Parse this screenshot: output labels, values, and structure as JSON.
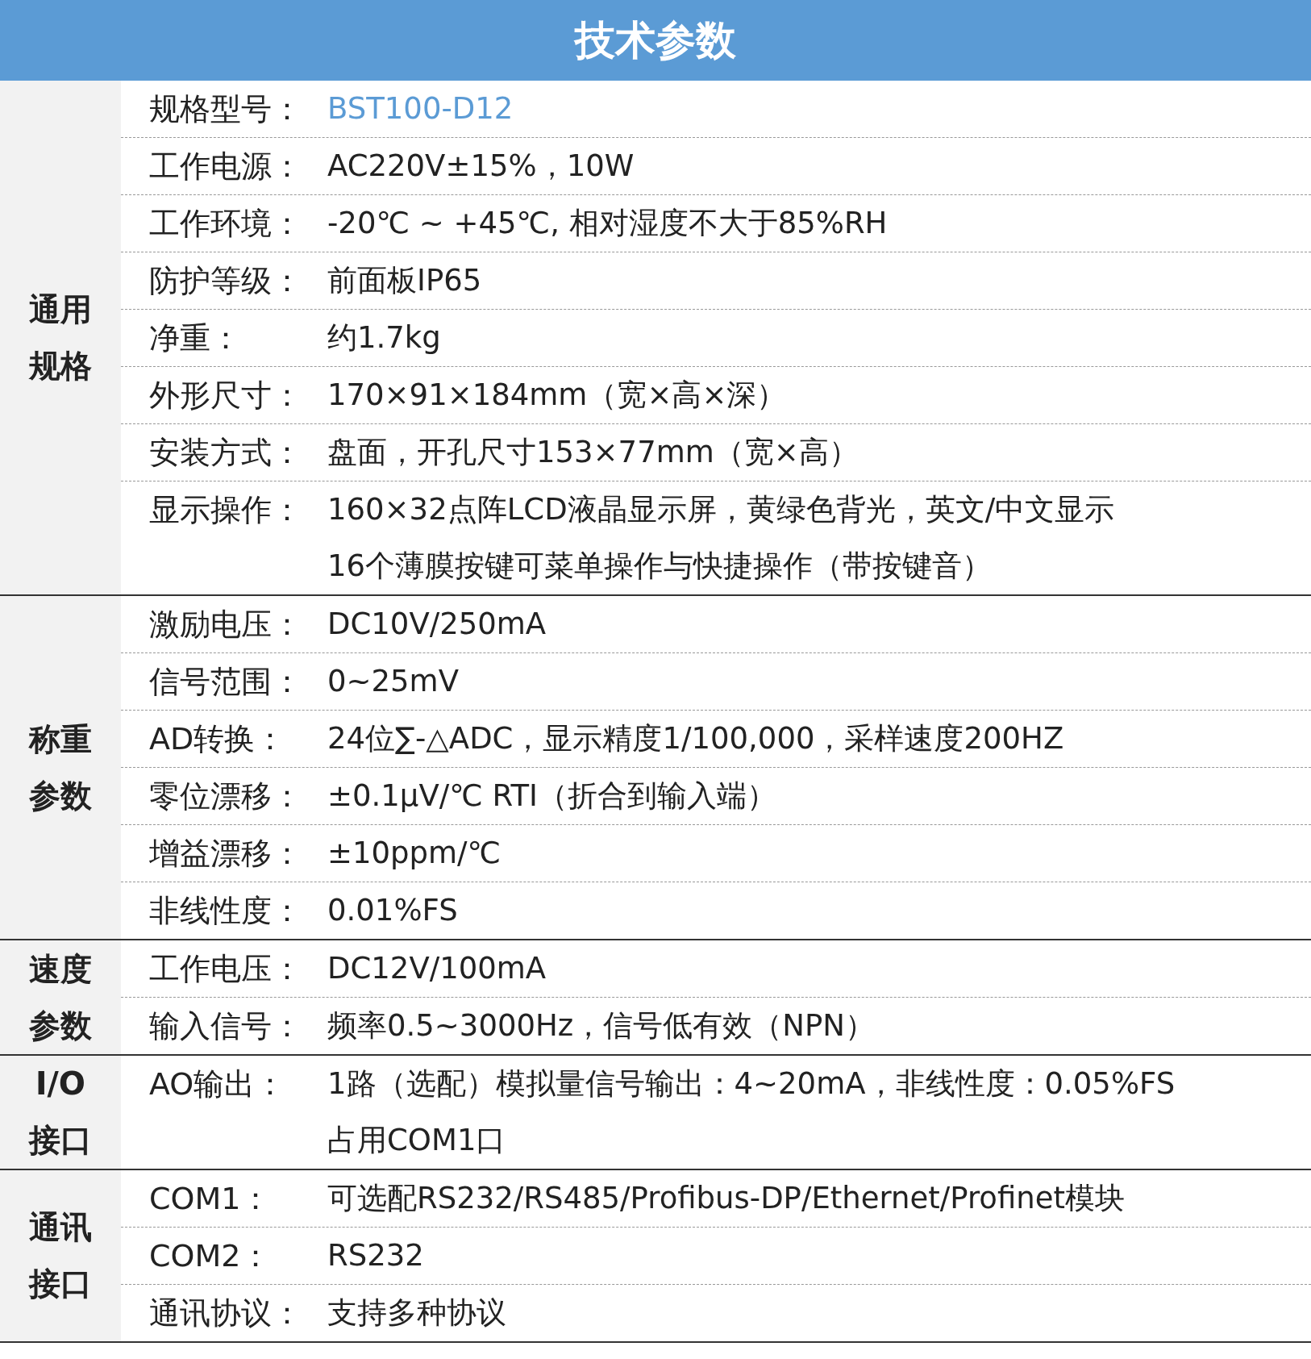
{
  "title": "技术参数",
  "groups": [
    {
      "label_lines": [
        "通用",
        "规格"
      ],
      "rows": [
        {
          "key": "规格型号：",
          "value_lines": [
            "BST100-D12"
          ],
          "color": "#5b9bd5"
        },
        {
          "key": "工作电源：",
          "value_lines": [
            "AC220V±15%，10W"
          ],
          "color": "#222222"
        },
        {
          "key": "工作环境：",
          "value_lines": [
            "-20℃ ~ +45℃, 相对湿度不大于85%RH"
          ],
          "color": "#222222"
        },
        {
          "key": "防护等级：",
          "value_lines": [
            "前面板IP65"
          ],
          "color": "#222222"
        },
        {
          "key": "净重：",
          "value_lines": [
            "约1.7kg"
          ],
          "color": "#222222"
        },
        {
          "key": "外形尺寸：",
          "value_lines": [
            "170×91×184mm（宽×高×深）"
          ],
          "color": "#222222"
        },
        {
          "key": "安装方式：",
          "value_lines": [
            "盘面，开孔尺寸153×77mm（宽×高）"
          ],
          "color": "#222222"
        },
        {
          "key": "显示操作：",
          "value_lines": [
            "160×32点阵LCD液晶显示屏，黄绿色背光，英文/中文显示",
            "16个薄膜按键可菜单操作与快捷操作（带按键音）"
          ],
          "color": "#222222"
        }
      ]
    },
    {
      "label_lines": [
        "称重",
        "参数"
      ],
      "rows": [
        {
          "key": "激励电压：",
          "value_lines": [
            "DC10V/250mA"
          ],
          "color": "#222222"
        },
        {
          "key": "信号范围：",
          "value_lines": [
            "0~25mV"
          ],
          "color": "#222222"
        },
        {
          "key": "AD转换：",
          "value_lines": [
            "24位∑-△ADC，显示精度1/100,000，采样速度200HZ"
          ],
          "color": "#222222"
        },
        {
          "key": "零位漂移：",
          "value_lines": [
            "±0.1μV/℃ RTI（折合到输入端）"
          ],
          "color": "#222222"
        },
        {
          "key": "增益漂移：",
          "value_lines": [
            "±10ppm/℃"
          ],
          "color": "#222222"
        },
        {
          "key": "非线性度：",
          "value_lines": [
            "0.01%FS"
          ],
          "color": "#222222"
        }
      ]
    },
    {
      "label_lines": [
        "速度",
        "参数"
      ],
      "rows": [
        {
          "key": "工作电压：",
          "value_lines": [
            "DC12V/100mA"
          ],
          "color": "#222222"
        },
        {
          "key": "输入信号：",
          "value_lines": [
            "频率0.5~3000Hz，信号低有效（NPN）"
          ],
          "color": "#222222"
        }
      ]
    },
    {
      "label_lines": [
        "I/O",
        "接口"
      ],
      "rows": [
        {
          "key": "AO输出：",
          "value_lines": [
            "1路（选配）模拟量信号输出：4~20mA，非线性度：0.05%FS",
            "占用COM1口"
          ],
          "color": "#222222"
        }
      ]
    },
    {
      "label_lines": [
        "通讯",
        "接口"
      ],
      "rows": [
        {
          "key": "COM1：",
          "value_lines": [
            "可选配RS232/RS485/Profibus-DP/Ethernet/Profinet模块"
          ],
          "color": "#222222"
        },
        {
          "key": "COM2：",
          "value_lines": [
            "RS232"
          ],
          "color": "#222222"
        },
        {
          "key": "通讯协议：",
          "value_lines": [
            "支持多种协议"
          ],
          "color": "#222222"
        }
      ]
    }
  ]
}
